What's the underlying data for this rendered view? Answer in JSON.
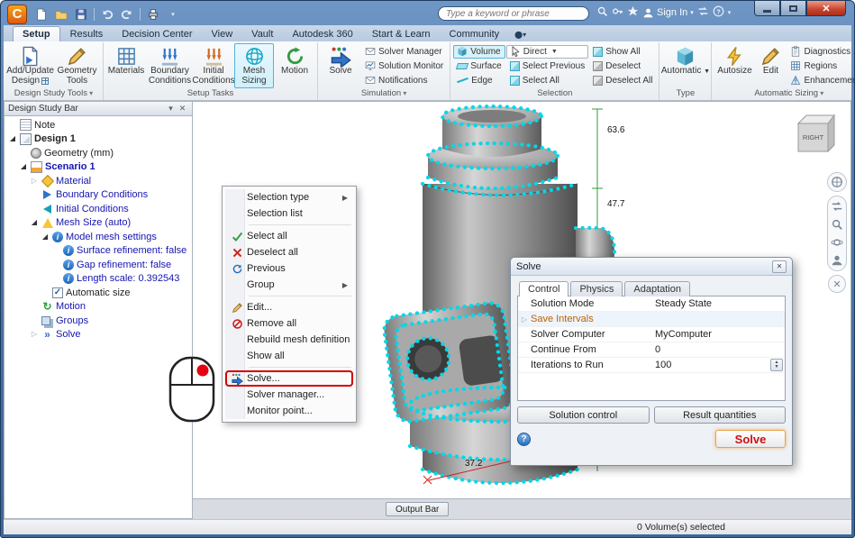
{
  "titlebar": {
    "search_placeholder": "Type a keyword or phrase",
    "sign_in": "Sign In"
  },
  "tabs": [
    {
      "label": "Setup"
    },
    {
      "label": "Results"
    },
    {
      "label": "Decision Center"
    },
    {
      "label": "View"
    },
    {
      "label": "Vault"
    },
    {
      "label": "Autodesk 360"
    },
    {
      "label": "Start & Learn"
    },
    {
      "label": "Community"
    }
  ],
  "ribbon": {
    "design_tools": {
      "label": "Design Study Tools",
      "add_update": {
        "l1": "Add/Update",
        "l2": "Design"
      },
      "geometry": {
        "l1": "Geometry",
        "l2": "Tools"
      }
    },
    "setup_tasks": {
      "label": "Setup Tasks",
      "materials": "Materials",
      "boundary": {
        "l1": "Boundary",
        "l2": "Conditions"
      },
      "initial": {
        "l1": "Initial",
        "l2": "Conditions"
      },
      "mesh": {
        "l1": "Mesh",
        "l2": "Sizing"
      },
      "motion": "Motion"
    },
    "simulation": {
      "label": "Simulation",
      "solve": "Solve",
      "solver_manager": "Solver Manager",
      "solution_monitor": "Solution Monitor",
      "notifications": "Notifications"
    },
    "selection": {
      "label": "Selection",
      "volume": "Volume",
      "surface": "Surface",
      "edge": "Edge",
      "direct": "Direct",
      "select_previous": "Select Previous",
      "select_all": "Select All",
      "show_all": "Show All",
      "deselect": "Deselect",
      "deselect_all": "Deselect All"
    },
    "type": {
      "label": "Type",
      "automatic": "Automatic"
    },
    "auto_sizing": {
      "label": "Automatic Sizing",
      "autosize": "Autosize",
      "edit": "Edit",
      "diagnostics": "Diagnostics",
      "regions": "Regions",
      "enhancement": "Enhancement"
    }
  },
  "design_study_bar": {
    "title": "Design Study Bar",
    "items": [
      {
        "label": "Note"
      },
      {
        "label": "Design 1"
      },
      {
        "label": "Geometry (mm)"
      },
      {
        "label": "Scenario 1"
      },
      {
        "label": "Material"
      },
      {
        "label": "Boundary Conditions"
      },
      {
        "label": "Initial Conditions"
      },
      {
        "label": "Mesh Size (auto)"
      },
      {
        "label": "Model mesh settings"
      },
      {
        "label": "Surface refinement: false"
      },
      {
        "label": "Gap refinement: false"
      },
      {
        "label": "Length scale: 0.392543"
      },
      {
        "label": "Automatic size"
      },
      {
        "label": "Motion"
      },
      {
        "label": "Groups"
      },
      {
        "label": "Solve"
      }
    ]
  },
  "context_menu": {
    "items": [
      {
        "label": "Selection type"
      },
      {
        "label": "Selection list"
      },
      {
        "label": "Select all"
      },
      {
        "label": "Deselect all"
      },
      {
        "label": "Previous"
      },
      {
        "label": "Group"
      },
      {
        "label": "Edit..."
      },
      {
        "label": "Remove all"
      },
      {
        "label": "Rebuild mesh definition"
      },
      {
        "label": "Show all"
      },
      {
        "label": "Solve..."
      },
      {
        "label": "Solver manager..."
      },
      {
        "label": "Monitor point..."
      }
    ]
  },
  "solve_dialog": {
    "title": "Solve",
    "tabs": [
      {
        "label": "Control"
      },
      {
        "label": "Physics"
      },
      {
        "label": "Adaptation"
      }
    ],
    "rows": [
      {
        "label": "Solution Mode",
        "value": "Steady State"
      },
      {
        "label": "Save Intervals",
        "value": ""
      },
      {
        "label": "Solver Computer",
        "value": "MyComputer"
      },
      {
        "label": "Continue From",
        "value": "0"
      },
      {
        "label": "Iterations to Run",
        "value": "100"
      }
    ],
    "buttons": [
      {
        "label": "Solution control"
      },
      {
        "label": "Result quantities"
      }
    ],
    "solve_button": "Solve"
  },
  "viewport": {
    "dims": {
      "height_top": "63.6",
      "height_mid": "47.7",
      "width_bottom": "37.2"
    },
    "viewcube_face": "RIGHT"
  },
  "dock": {
    "output_bar": "Output Bar"
  },
  "statusbar": {
    "selection_info": "0 Volume(s) selected"
  },
  "colors": {
    "mesh_cyan": "#00d8e8",
    "highlight_red": "#d40000",
    "dim_green": "#2f9e3f",
    "dim_red": "#cc2222",
    "tree_blue": "#1515b0",
    "titlebar_blue": "#4c76a8"
  }
}
